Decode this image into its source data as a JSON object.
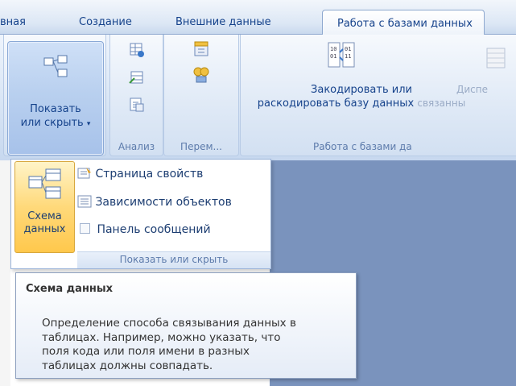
{
  "tabs": [
    "вная",
    "Создание",
    "Внешние данные",
    "Работа с базами данных"
  ],
  "show_hide_button": {
    "label_line1": "Показать",
    "label_line2": "или скрыть"
  },
  "groups": {
    "analyze_label": "Анализ",
    "move_label": "Перем...",
    "db_tools": {
      "encode_line1": "Закодировать или",
      "encode_line2": "раскодировать базу данных",
      "cut_line2": "связанны",
      "cut_line1": "Диспе",
      "label": "Работа с базами да"
    }
  },
  "dropdown": {
    "big_button_line1": "Схема",
    "big_button_line2": "данных",
    "items": [
      "Страница свойств",
      "Зависимости объектов",
      "Панель сообщений"
    ],
    "footer": "Показать или скрыть"
  },
  "tooltip": {
    "title": "Схема данных",
    "lines": [
      "Определение способа связывания данных в",
      "таблицах. Например, можно указать, что",
      "поля кода или поля имени в разных",
      "таблицах должны совпадать."
    ]
  },
  "colors": {
    "ribbon_text": "#15428b",
    "selection": "#ffd97a",
    "workspace": "#7a93bd"
  }
}
